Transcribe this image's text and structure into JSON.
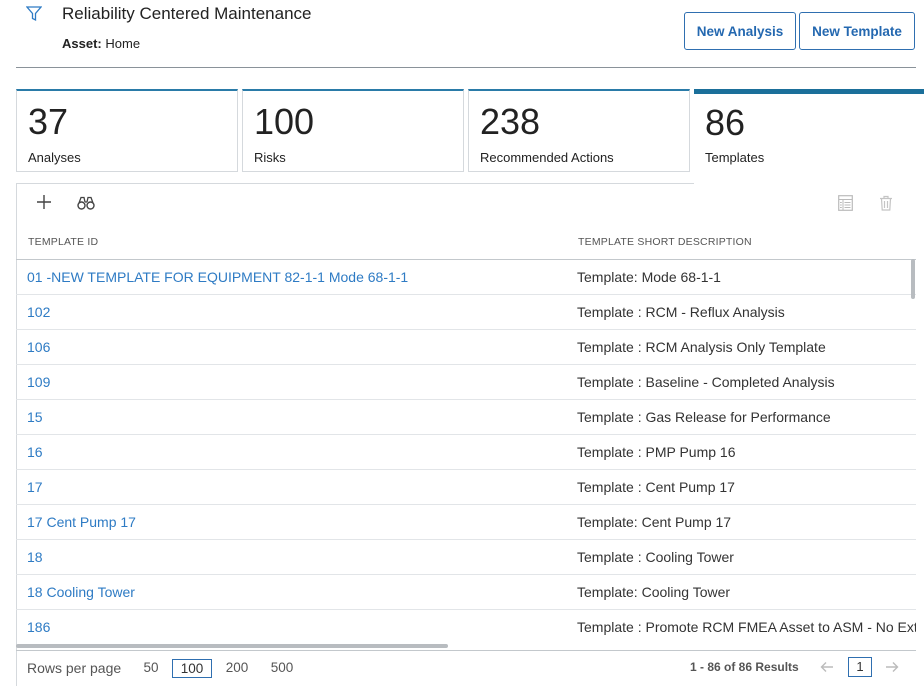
{
  "header": {
    "title": "Reliability Centered Maintenance",
    "asset_label": "Asset:",
    "asset_value": "Home",
    "new_analysis": "New Analysis",
    "new_template": "New Template"
  },
  "tiles": [
    {
      "count": "37",
      "label": "Analyses"
    },
    {
      "count": "100",
      "label": "Risks"
    },
    {
      "count": "238",
      "label": "Recommended Actions"
    },
    {
      "count": "86",
      "label": "Templates"
    }
  ],
  "grid": {
    "columns": [
      "TEMPLATE ID",
      "TEMPLATE SHORT DESCRIPTION"
    ],
    "rows": [
      {
        "id": "01 -NEW TEMPLATE FOR EQUIPMENT 82-1-1 Mode 68-1-1",
        "desc": "Template: Mode 68-1-1"
      },
      {
        "id": "102",
        "desc": "Template : RCM - Reflux Analysis"
      },
      {
        "id": "106",
        "desc": "Template : RCM Analysis Only Template"
      },
      {
        "id": "109",
        "desc": "Template : Baseline - Completed Analysis"
      },
      {
        "id": "15",
        "desc": "Template : Gas Release for Performance"
      },
      {
        "id": "16",
        "desc": "Template : PMP Pump 16"
      },
      {
        "id": "17",
        "desc": "Template : Cent Pump 17"
      },
      {
        "id": "17 Cent Pump 17",
        "desc": "Template: Cent Pump 17"
      },
      {
        "id": "18",
        "desc": "Template : Cooling Tower"
      },
      {
        "id": "18 Cooling Tower",
        "desc": "Template: Cooling Tower"
      },
      {
        "id": "186",
        "desc": "Template : Promote RCM FMEA Asset to ASM - No External"
      }
    ]
  },
  "footer": {
    "rows_per_page_label": "Rows per page",
    "page_sizes": [
      "50",
      "100",
      "200",
      "500"
    ],
    "selected_page_size": "100",
    "results": "1 - 86 of 86 Results",
    "current_page": "1"
  },
  "colors": {
    "accent": "#2f6fb0",
    "link": "#2e7bc4",
    "active_tile_bar": "#1b6f9a"
  }
}
